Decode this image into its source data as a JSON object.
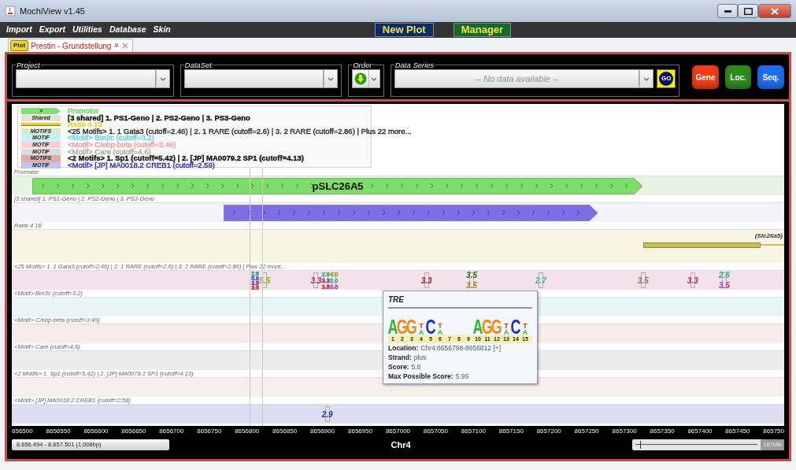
{
  "window": {
    "title": "MochiView v1.45"
  },
  "menu": [
    "Import",
    "Export",
    "Utilities",
    "Database",
    "Skin"
  ],
  "toolbar_buttons": [
    {
      "label": "New Plot",
      "kind": "blue"
    },
    {
      "label": "Manager",
      "kind": "green"
    }
  ],
  "tabs": [
    {
      "badge": "Plot",
      "label": "Prestin - Grundstellung",
      "selected": true
    }
  ],
  "selectors": [
    {
      "legend": "Project",
      "kind": "combo"
    },
    {
      "legend": "DataSet",
      "kind": "combo"
    },
    {
      "legend": "Order",
      "kind": "order"
    },
    {
      "legend": "Data Series",
      "kind": "series",
      "placeholder": "-- No data available --",
      "go": "GO"
    }
  ],
  "action_buttons": [
    {
      "label": "Gene",
      "color": "#f23c12"
    },
    {
      "label": "Loc.",
      "color": "#2f8a1c"
    },
    {
      "label": "Seq.",
      "color": "#1e6ef2"
    }
  ],
  "legend": [
    {
      "swatch": {
        "kind": "arrow",
        "text": ">",
        "color": "#7ee06e"
      },
      "label": {
        "text": "Promotor",
        "color": "#62d64e",
        "bold": false
      }
    },
    {
      "swatch": {
        "kind": "box",
        "text": "Shared",
        "color": "#e2e2e2"
      },
      "label": {
        "text": "[3 shared]  1. PS1-Geno | 2. PS2-Geno | 3. PS3-Geno",
        "color": "#111111",
        "bold": true
      }
    },
    {
      "swatch": {
        "kind": "line",
        "color": "#e6d21a"
      },
      "label": {
        "text": "Ratte 4 18",
        "color": "#e6d21a",
        "bold": false
      }
    },
    {
      "swatch": {
        "kind": "box",
        "text": "MOTIFS",
        "color": "#d6ead0"
      },
      "label": {
        "text": "<25 Motifs> 1. 1 Gata3 (cutoff=2.46) | 2. 1 RARE (cutoff=2.6) | 3. 2 RARE (cutoff=2.86) | Plus 22 more...",
        "color": "#222222",
        "bold": false
      }
    },
    {
      "swatch": {
        "kind": "box",
        "text": "MOTIF",
        "color": "#c6f2f6"
      },
      "label": {
        "text": "<Motif> Brn3c (cutoff=3.2)",
        "color": "#4ed8ea",
        "bold": false
      }
    },
    {
      "swatch": {
        "kind": "box",
        "text": "MOTIF",
        "color": "#f6d2d2"
      },
      "label": {
        "text": "<Motif> C/ebp-beta (cutoff=3.46)",
        "color": "#f29a9a",
        "bold": false
      }
    },
    {
      "swatch": {
        "kind": "box",
        "text": "MOTIF",
        "color": "#dcdcdc"
      },
      "label": {
        "text": "<Motif> Care (cutoff=4.6)",
        "color": "#a6a6a6",
        "bold": false
      }
    },
    {
      "swatch": {
        "kind": "box",
        "text": "MOTIFS",
        "color": "#dcaea6"
      },
      "label": {
        "text": "<2 Motifs> 1. Sp1 (cutoff=5.42) | 2. [JP] MA0079.2 SP1 (cutoff=4.13)",
        "color": "#111111",
        "bold": true
      }
    },
    {
      "swatch": {
        "kind": "box",
        "text": "MOTIF",
        "color": "#c2c2f0"
      },
      "label": {
        "text": "<Motif> [JP] MA0018.2 CREB1 (cutoff=2.59)",
        "color": "#2424d0",
        "bold": false
      }
    }
  ],
  "tracks": [
    {
      "label": "Promotor",
      "kind": "gene",
      "color": "#e4f4e0",
      "features": [
        {
          "kind": "arrow",
          "name": "pSLC26A5",
          "color": "#7ddc6a"
        }
      ]
    },
    {
      "label": "[3 shared]  1. PS1-Geno | 2. PS2-Geno | 3. PS3-Geno",
      "kind": "gene",
      "color": "#f5f3fa",
      "features": [
        {
          "kind": "arrow",
          "color": "#7b6fe8"
        }
      ]
    },
    {
      "label": "Ratte 4 18",
      "kind": "transcript",
      "color": "#f6f4e2",
      "features": [
        {
          "kind": "bar",
          "name": "(Slc26a5)",
          "color": "#c8bf5a",
          "continues": true
        }
      ]
    },
    {
      "label": "<25 Motifs> 1. 1 Gata3 (cutoff=2.46) | 2. 1 RARE (cutoff=2.6) | 3. 2 RARE (cutoff=2.86) | Plus 22 more...",
      "kind": "motif",
      "color": "#f2e2ea",
      "marks": [
        {
          "scores": [
            {
              "text": "1.6",
              "color": "#2a9a7a"
            },
            {
              "text": "5.8",
              "color": "#3a5ad0"
            },
            {
              "text": "3.5",
              "color": "#8a2a8a"
            },
            {
              "text": "3.5",
              "color": "#c03030"
            }
          ]
        },
        {
          "scores": [
            {
              "text": "5.5",
              "color": "#8aaa20"
            }
          ]
        },
        {
          "scores": [
            {
              "text": "3.3",
              "color": "#a02a50"
            }
          ]
        },
        {
          "scores": [
            {
              "text": "2.6",
              "color": "#3ab86a"
            },
            {
              "text": "3.3",
              "color": "#8a2a8a"
            },
            {
              "text": "3.5",
              "color": "#c03030"
            }
          ]
        },
        {
          "scores": [
            {
              "text": "4.0",
              "color": "#8aaa30"
            },
            {
              "text": "2.6",
              "color": "#3ab86a"
            },
            {
              "text": "3.5",
              "color": "#c83ac8"
            }
          ]
        },
        {
          "scores": [
            {
              "text": "3.3",
              "color": "#8a2030"
            }
          ]
        },
        {
          "scores": [
            {
              "text": "3.5",
              "color": "#1a6a1a"
            },
            {
              "text": "3.5",
              "color": "#9a8a10"
            }
          ]
        },
        {
          "scores": [
            {
              "text": "2.7",
              "color": "#3ab88a"
            }
          ]
        },
        {
          "scores": [
            {
              "text": "3.5",
              "color": "#9a6a6a"
            }
          ]
        },
        {
          "scores": [
            {
              "text": "3.3",
              "color": "#a02a50"
            }
          ]
        },
        {
          "scores": [
            {
              "text": "2.6",
              "color": "#2aa88a"
            },
            {
              "text": "3.5",
              "color": "#c02ac0"
            }
          ]
        }
      ]
    },
    {
      "label": "<Motif> Brn3c (cutoff=3.2)",
      "kind": "motif",
      "color": "#e6f5f7"
    },
    {
      "label": "<Motif> C/ebp-beta (cutoff=3.46)",
      "kind": "motif",
      "color": "#f8ebeb"
    },
    {
      "label": "<Motif> Care (cutoff=4.6)",
      "kind": "motif",
      "color": "#ececec"
    },
    {
      "label": "<2 Motifs> 1. Sp1 (cutoff=5.42) | 2. [JP] MA0079.2 SP1 (cutoff=4.13)",
      "kind": "motif",
      "color": "#f7eded"
    },
    {
      "label": "<Motif> [JP] MA0018.2 CREB1 (cutoff=2.59)",
      "kind": "motif",
      "color": "#dddcf0",
      "marks": [
        {
          "scores": [
            {
              "text": "2.9",
              "color": "#2a2ab0"
            }
          ]
        }
      ]
    }
  ],
  "tooltip": {
    "title": "TRE",
    "logo": [
      {
        "kind": "big",
        "letters": [
          {
            "letter": "A",
            "color": "#2eb82e"
          }
        ]
      },
      {
        "kind": "big",
        "letters": [
          {
            "letter": "G",
            "color": "#f08a10"
          }
        ]
      },
      {
        "kind": "big",
        "letters": [
          {
            "letter": "G",
            "color": "#f08a10"
          }
        ]
      },
      {
        "kind": "small",
        "letters": [
          {
            "letter": "T",
            "color": "#e03030"
          },
          {
            "letter": "A",
            "color": "#2eb82e"
          }
        ]
      },
      {
        "kind": "big",
        "letters": [
          {
            "letter": "C",
            "color": "#1a2ae0"
          }
        ]
      },
      {
        "kind": "small",
        "letters": [
          {
            "letter": "T",
            "color": "#e03030"
          },
          {
            "letter": "A",
            "color": "#2eb82e"
          }
        ]
      },
      {
        "kind": "blank"
      },
      {
        "kind": "blank"
      },
      {
        "kind": "blank"
      },
      {
        "kind": "big",
        "letters": [
          {
            "letter": "A",
            "color": "#2eb82e"
          }
        ]
      },
      {
        "kind": "big",
        "letters": [
          {
            "letter": "G",
            "color": "#f08a10"
          }
        ]
      },
      {
        "kind": "big",
        "letters": [
          {
            "letter": "G",
            "color": "#f08a10"
          }
        ]
      },
      {
        "kind": "small",
        "letters": [
          {
            "letter": "T",
            "color": "#e03030"
          },
          {
            "letter": "A",
            "color": "#2eb82e"
          }
        ]
      },
      {
        "kind": "big",
        "letters": [
          {
            "letter": "C",
            "color": "#1a2ae0"
          }
        ]
      },
      {
        "kind": "small",
        "letters": [
          {
            "letter": "T",
            "color": "#e03030"
          },
          {
            "letter": "A",
            "color": "#2eb82e"
          }
        ]
      }
    ],
    "positions": [
      "1",
      "2",
      "3",
      "4",
      "5",
      "6",
      "7",
      "8",
      "9",
      "10",
      "11",
      "12",
      "13",
      "14",
      "15"
    ],
    "fields": [
      {
        "label": "Location:",
        "value": "Chr4:8656798-8656812 [+]"
      },
      {
        "label": "Strand:",
        "value": "plus"
      },
      {
        "label": "Score:",
        "value": "5.8"
      },
      {
        "label": "Max Possible Score:",
        "value": "5.99"
      }
    ]
  },
  "axis": {
    "ticks": [
      "656500",
      "8656550",
      "8656600",
      "8656650",
      "8656700",
      "8656750",
      "8656800",
      "8656850",
      "8656900",
      "8656950",
      "8657000",
      "8657050",
      "8657100",
      "8657150",
      "8657200",
      "8657250",
      "8657300",
      "8657350",
      "8657400",
      "8657450",
      "865750"
    ],
    "chromosome": "Chr4"
  },
  "status": {
    "range": "8.656.494 - 8.657.501 (1.008bp)",
    "zoom": {
      "level": 0.04
    },
    "memory": "187MB"
  }
}
